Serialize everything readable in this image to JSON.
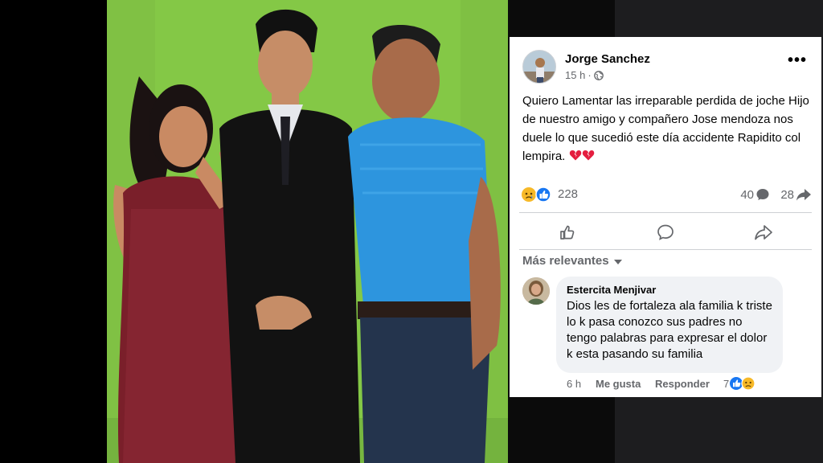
{
  "post": {
    "author": "Jorge Sanchez",
    "time": "15 h",
    "privacy_icon": "globe-icon",
    "text": "Quiero Lamentar las irreparable perdida de joche Hijo de nuestro amigo y compañero Jose mendoza nos duele lo que sucedió este día accidente Rapidito col lempira.",
    "reactions_count": "228",
    "comments_count": "40",
    "shares_count": "28",
    "icons": [
      "sad-reaction-icon",
      "like-reaction-icon",
      "comment-bubble-icon",
      "share-arrow-icon",
      "broken-heart-icon"
    ]
  },
  "actions": {
    "like_icon": "thumbs-up-icon",
    "comment_icon": "comment-icon",
    "share_icon": "share-icon"
  },
  "comments": {
    "sort_label": "Más relevantes",
    "items": [
      {
        "author": "Estercita Menjivar",
        "text": "Dios les de fortaleza ala familia k triste lo k pasa conozco sus padres no tengo palabras para expresar el dolor k esta pasando su familia",
        "time": "6 h",
        "like_label": "Me gusta",
        "reply_label": "Responder",
        "reaction_count": "7"
      }
    ]
  },
  "colors": {
    "facebook_blue": "#1877f2",
    "meta_gray": "#65676b",
    "bubble_bg": "#f0f2f5",
    "wall_green": "#86c947"
  }
}
